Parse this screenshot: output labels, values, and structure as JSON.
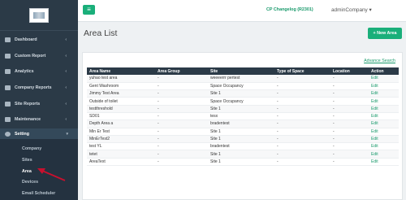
{
  "sidebar": {
    "items": [
      {
        "label": "Dashboard",
        "icon": "dashboard-icon"
      },
      {
        "label": "Custom Report",
        "icon": "report-icon"
      },
      {
        "label": "Analytics",
        "icon": "analytics-icon"
      },
      {
        "label": "Company Reports",
        "icon": "company-report-icon"
      },
      {
        "label": "Site Reports",
        "icon": "site-report-icon"
      },
      {
        "label": "Maintenance",
        "icon": "wrench-icon"
      },
      {
        "label": "Setting",
        "icon": "gear-icon"
      }
    ],
    "sub_items": [
      "Company",
      "Sites",
      "Area",
      "Devices",
      "Email Scheduler"
    ]
  },
  "topbar": {
    "changelog": "CP Changelog (R2301)",
    "user": "adminCompany ▾"
  },
  "page": {
    "title": "Area List",
    "new_button": "+ New Area",
    "advance_search": "Advance Search"
  },
  "table": {
    "headers": [
      "Area Name",
      "Area Group",
      "Site",
      "Type of Space",
      "Location",
      "Action"
    ],
    "rows": [
      [
        "yuhao test area",
        "-",
        "weeeerrr pertest",
        "-",
        "-",
        "Edit"
      ],
      [
        "Gent Washroom",
        "-",
        "Space Occupancy",
        "-",
        "-",
        "Edit"
      ],
      [
        "Jimmy Test Area",
        "-",
        "Site 1",
        "-",
        "-",
        "Edit"
      ],
      [
        "Outside of toilet",
        "-",
        "Space Occupancy",
        "-",
        "-",
        "Edit"
      ],
      [
        "testthreshold",
        "-",
        "Site 1",
        "-",
        "-",
        "Edit"
      ],
      [
        "SD01",
        "-",
        "tesx",
        "-",
        "-",
        "Edit"
      ],
      [
        "Depth Area a",
        "-",
        "bradentest",
        "-",
        "-",
        "Edit"
      ],
      [
        "Min Er Test",
        "-",
        "Site 1",
        "-",
        "-",
        "Edit"
      ],
      [
        "MinErTest2",
        "-",
        "Site 1",
        "-",
        "-",
        "Edit"
      ],
      [
        "test YL",
        "-",
        "bradentest",
        "-",
        "-",
        "Edit"
      ],
      [
        "tetet",
        "-",
        "Site 1",
        "-",
        "-",
        "Edit"
      ],
      [
        "AreaText",
        "-",
        "Site 1",
        "-",
        "-",
        "Edit"
      ]
    ]
  },
  "colors": {
    "accent": "#1aaf7a",
    "sidebar": "#2b3a47",
    "annotation": "#c8102e"
  }
}
